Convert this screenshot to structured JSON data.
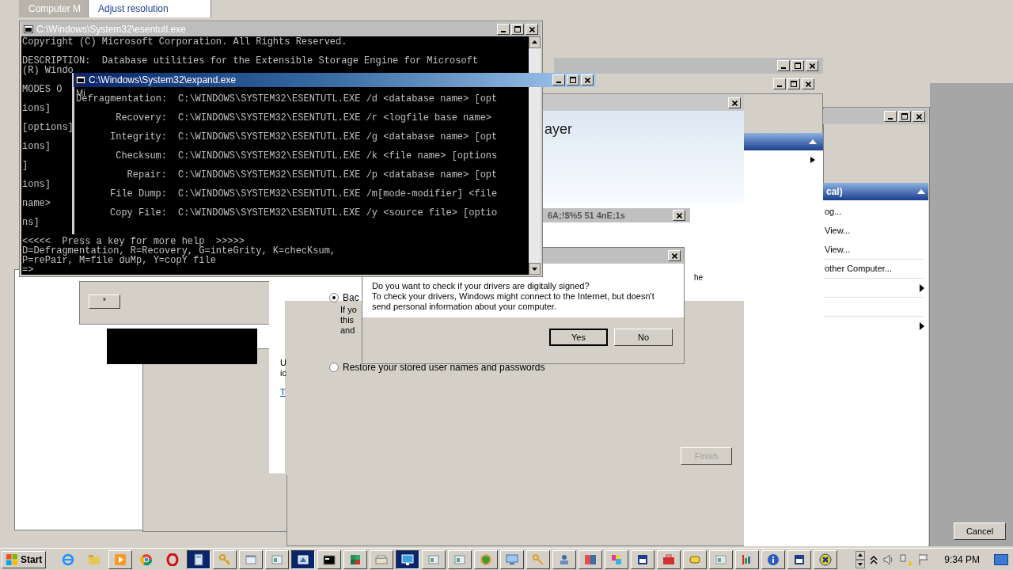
{
  "background_tabs": [
    {
      "label": "Computer M",
      "selected": false
    },
    {
      "label": "Adjust resolution",
      "selected": true
    }
  ],
  "esentutl_window": {
    "title": "C:\\Windows\\System32\\esentutl.exe",
    "top_lines": [
      "Copyright (C) Microsoft Corporation. All Rights Reserved.",
      "DESCRIPTION:  Database utilities for the Extensible Storage Engine for Microsoft",
      "(R) Windo"
    ],
    "side_fragments": [
      "MODES O",
      "ions]",
      "[options]",
      "ions]",
      "]",
      "ions]",
      "name>",
      "ns]"
    ],
    "bottom_lines": [
      "<<<<<  Press a key for more help  >>>>>",
      "D=Defragmentation, R=Recovery, G=inteGrity, K=checKsum,",
      "P=rePair, M=file duMp, Y=copY file",
      "=>"
    ]
  },
  "expand_window": {
    "title": "C:\\Windows\\System32\\expand.exe",
    "overlay_text": "Mi",
    "rows": [
      {
        "label": "Defragmentation:",
        "command": "C:\\WINDOWS\\SYSTEM32\\ESENTUTL.EXE /d <database name> [opt"
      },
      {
        "label": "Recovery:",
        "command": "C:\\WINDOWS\\SYSTEM32\\ESENTUTL.EXE /r <logfile base name>"
      },
      {
        "label": "Integrity:",
        "command": "C:\\WINDOWS\\SYSTEM32\\ESENTUTL.EXE /g <database name> [opt"
      },
      {
        "label": "Checksum:",
        "command": "C:\\WINDOWS\\SYSTEM32\\ESENTUTL.EXE /k <file name> [options"
      },
      {
        "label": "Repair:",
        "command": "C:\\WINDOWS\\SYSTEM32\\ESENTUTL.EXE /p <database name> [opt"
      },
      {
        "label": "File Dump:",
        "command": "C:\\WINDOWS\\SYSTEM32\\ESENTUTL.EXE /m[mode-modifier] <file"
      },
      {
        "label": "Copy File:",
        "command": "C:\\WINDOWS\\SYSTEM32\\ESENTUTL.EXE /y <source file> [optio"
      }
    ]
  },
  "small_button": "*",
  "wizard": {
    "heading": "ayer",
    "ghost_title": "6A;!$%5 51 4nE;1s",
    "stray_text": "he",
    "options": [
      {
        "label": "Bac",
        "selected": true,
        "lines": [
          "If yo",
          "this",
          "and"
        ]
      },
      {
        "label": "Restore your stored user names and passwords",
        "selected": false
      }
    ],
    "side_text": [
      "U",
      "ic"
    ],
    "link": "T",
    "finish_button": {
      "label": "Finish",
      "disabled": true
    }
  },
  "dialog": {
    "lines": [
      "Do you want to check if your drivers are digitally signed?",
      "To check your drivers, Windows might connect to the Internet, but doesn't",
      "send personal information about your computer."
    ],
    "buttons": [
      {
        "label": "Yes",
        "selected": true
      },
      {
        "label": "No",
        "selected": false
      }
    ]
  },
  "mmc_panel": {
    "header": "cal)",
    "items": [
      {
        "kind": "action",
        "label": "og..."
      },
      {
        "kind": "action",
        "label": "View..."
      },
      {
        "kind": "action",
        "label": "View..."
      },
      {
        "kind": "action",
        "label": "other Computer..."
      },
      {
        "kind": "submenu"
      },
      {
        "kind": "blank"
      },
      {
        "kind": "submenu"
      }
    ]
  },
  "cancel_button": "Cancel",
  "taskbar": {
    "start": "Start",
    "clock": "9:34 PM",
    "buttons": [
      {
        "kind": "launcher",
        "selected": false
      },
      {
        "kind": "launcher",
        "selected": false
      },
      {
        "kind": "button",
        "selected": false
      },
      {
        "kind": "launcher",
        "selected": false
      },
      {
        "kind": "launcher",
        "selected": false
      },
      {
        "kind": "button",
        "selected": true
      },
      {
        "kind": "button",
        "selected": false
      },
      {
        "kind": "button",
        "selected": false
      },
      {
        "kind": "button",
        "selected": false
      },
      {
        "kind": "button",
        "selected": true
      },
      {
        "kind": "button",
        "selected": false
      },
      {
        "kind": "button",
        "selected": false
      },
      {
        "kind": "button",
        "selected": false
      },
      {
        "kind": "button",
        "selected": true
      },
      {
        "kind": "button",
        "selected": false
      },
      {
        "kind": "button",
        "selected": false
      },
      {
        "kind": "button",
        "selected": false
      },
      {
        "kind": "button",
        "selected": false
      },
      {
        "kind": "button",
        "selected": false
      },
      {
        "kind": "button",
        "selected": false
      },
      {
        "kind": "button",
        "selected": false
      },
      {
        "kind": "button",
        "selected": false
      },
      {
        "kind": "button",
        "selected": false
      },
      {
        "kind": "button",
        "selected": false
      },
      {
        "kind": "button",
        "selected": false
      },
      {
        "kind": "button",
        "selected": false
      },
      {
        "kind": "button",
        "selected": false
      },
      {
        "kind": "button",
        "selected": false
      },
      {
        "kind": "button",
        "selected": false
      },
      {
        "kind": "button",
        "selected": false
      }
    ]
  }
}
